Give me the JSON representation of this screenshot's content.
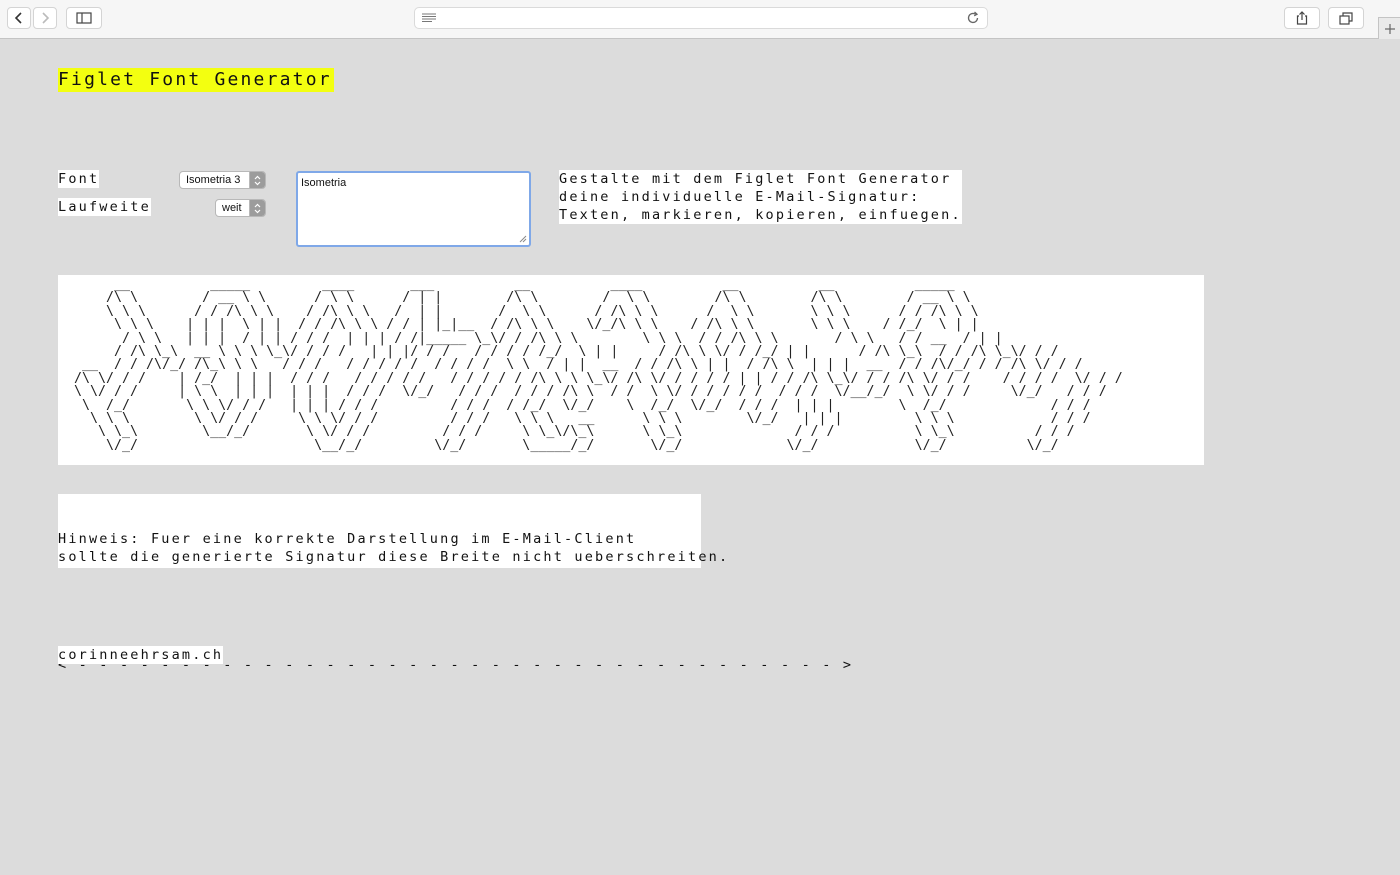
{
  "browser": {
    "back_icon": "chevron-left-icon",
    "forward_icon": "chevron-right-icon",
    "sidebar_icon": "sidebar-icon",
    "reader_icon": "reader-lines-icon",
    "reload_icon": "reload-icon",
    "share_icon": "share-icon",
    "tabs_icon": "tabs-icon",
    "new_tab_icon": "plus-icon"
  },
  "page": {
    "title": "Figlet Font Generator",
    "title_highlight_color": "#f3ff10",
    "font_label": "Font",
    "font_value": "Isometria 3",
    "spacing_label": "Laufweite",
    "spacing_value": "weit",
    "text_input": "Isometria",
    "description": "Gestalte mit dem Figlet Font Generator\ndeine individuelle E-Mail-Signatur:\nTexten, markieren, kopieren, einfuegen.",
    "ascii_output": "      __          _____         ____       ___          __          ____          __          __          _____\n     /\\ \\        / __ \\ \\      / \\ \\      / | |        /\\ \\        /  \\ \\        /\\ \\        /\\ \\        / __ \\ \\\n     \\ \\ \\      / / /\\ \\ \\    / /\\ \\ \\   /  | |       /  \\ \\      / /\\ \\ \\      /  \\ \\       \\ \\ \\      / / /\\ \\ \\\n      \\ \\ \\    | | |  \\ | |  / / /\\ \\ \\ / / | |_|__  / /\\ \\ \\    \\/_/\\ \\ \\    / /\\ \\ \\       \\ \\ \\    / /_/  \\ | |\n       / \\ \\   | | |  / | | / / /  | | | / /|_____ \\_\\/ / /\\ \\ \\        \\ \\ \\  / / /\\ \\ \\       / \\ \\   / / __  / | |\n      / /\\ \\_\\  __ \\ \\ \\ \\_\\/ / / /   | | |/ / /   / / / / /_/  \\ | |     / /\\ \\ \\/ / /_/ | |      / /\\ \\_\\  / / /\\ \\_\\/ / /\n  __  / / /\\/_/ /\\_\\ \\ \\   / / /   / / / / /  / / / /  \\ \\  / | |  __  / / /\\ \\ | |  / /\\ \\  | | |  __  / / /\\/_/ / / /\\ \\/ / /\n /\\ \\/ / /    | /_/  | | |  / / /   / / / / /   / / / / / /\\ \\ \\ \\_\\/ /\\ \\/ / / / / | | / / /\\ \\_\\/ / / /\\ \\/ / /    / / / /  \\/ / /\n \\ \\/ / /     | \\ \\  | | |  | | |  / / /  \\/_/   / / /  / / / /\\ \\  / /  \\ \\/ / / / / /  / / /  \\/__/_/  \\ \\/ / /     \\/_/   / / /\n  \\  /_/       \\ \\ \\/ / /   | | | / / /         / / /  / /_/  \\/_/    \\  /_/  \\/_/  / / /  | | |        \\  /_/             / / /\n   \\ \\ \\        \\ \\/ / /     \\ \\ \\/ / /         / / /   \\ \\ \\   __      \\ \\ \\        \\/_/   | | |         \\ \\ \\            / / /\n    \\ \\_\\        \\__/_/       \\ \\/ / /         / / /     \\ \\_\\/\\_\\      \\ \\_\\              / / /          \\ \\_\\          / / /\n     \\/_/                      \\__/_/         \\/_/       \\_____/_/       \\/_/             \\/_/            \\/_/          \\/_/",
    "hint": "Hinweis: Fuer eine korrekte Darstellung im E-Mail-Client\nsollte die generierte Signatur diese Breite nicht ueberschreiten.",
    "width_ruler": "< - - - - - - - - - - - - - - - - - - - - - - - - - - - - - - - - - - - - - >",
    "footer_link": "corinneehrsam.ch"
  }
}
